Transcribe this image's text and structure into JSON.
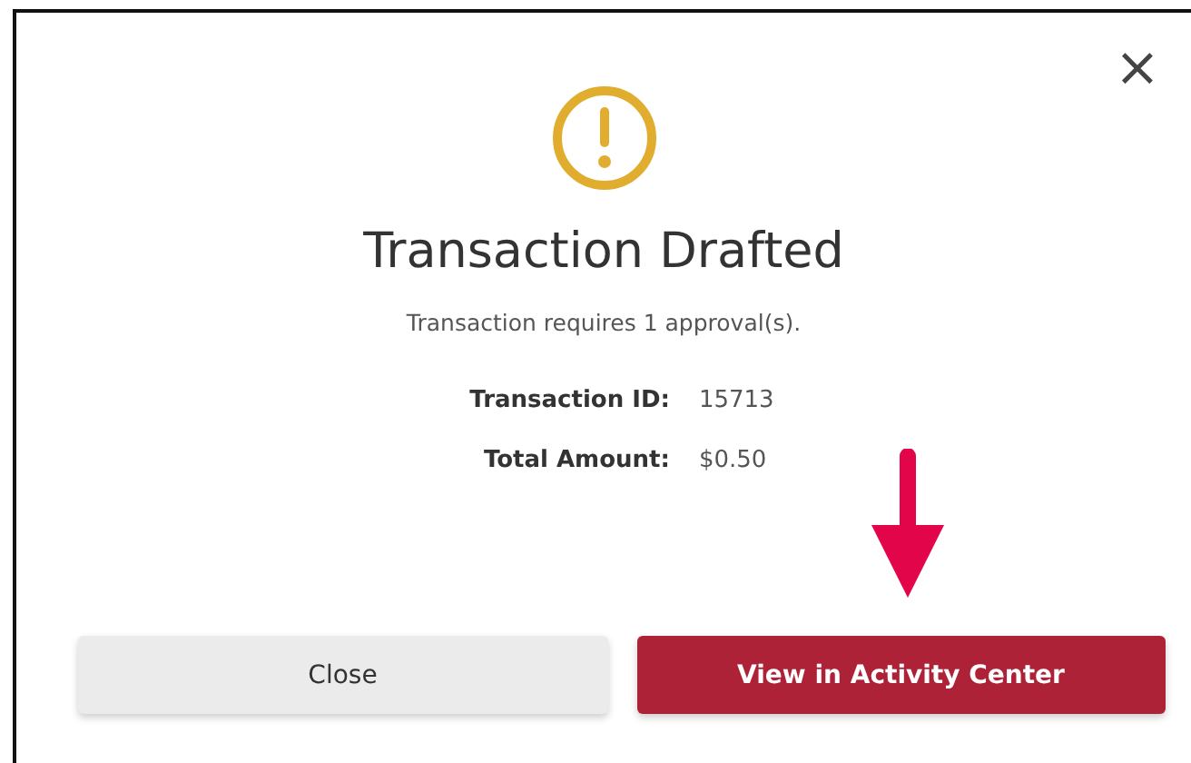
{
  "dialog": {
    "close_glyph": "×",
    "title": "Transaction Drafted",
    "message": "Transaction requires 1 approval(s).",
    "details": [
      {
        "label": "Transaction ID:",
        "value": "15713"
      },
      {
        "label": "Total Amount:",
        "value": "$0.50"
      }
    ],
    "buttons": [
      {
        "label": "Close",
        "kind": "secondary"
      },
      {
        "label": "View in Activity Center",
        "kind": "primary"
      }
    ]
  }
}
